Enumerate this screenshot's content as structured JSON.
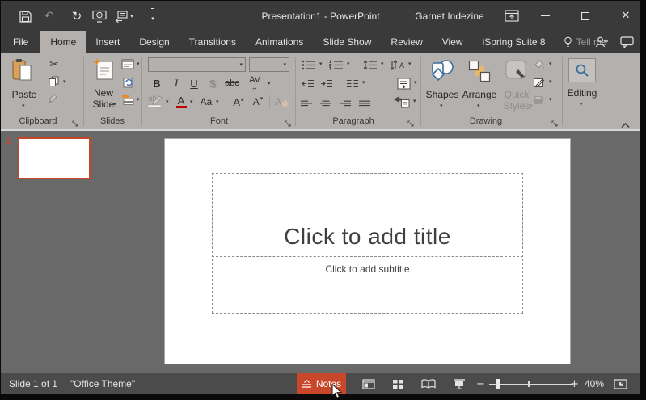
{
  "window": {
    "title": "Presentation1  -  PowerPoint",
    "account": "Garnet Indezine"
  },
  "colors": {
    "accent": "#c8462a",
    "chrome": "#3a3a3a",
    "ribbon_bg": "#b4b0ad",
    "canvas_bg": "#696969",
    "statusbar_bg": "#4b4b4b"
  },
  "icons": {
    "dropdown": "▾",
    "scissors": "✂",
    "undo": "↶",
    "repeat": "↻",
    "close": "✕",
    "zoom_out": "−",
    "zoom_in": "+",
    "spacing_arrows": "↔"
  },
  "tabs": {
    "items": [
      {
        "label": "File"
      },
      {
        "label": "Home"
      },
      {
        "label": "Insert"
      },
      {
        "label": "Design"
      },
      {
        "label": "Transitions"
      },
      {
        "label": "Animations"
      },
      {
        "label": "Slide Show"
      },
      {
        "label": "Review"
      },
      {
        "label": "View"
      },
      {
        "label": "iSpring Suite 8"
      }
    ],
    "active": "Home",
    "tellme": "Tell me"
  },
  "ribbon": {
    "clipboard": {
      "label": "Clipboard",
      "paste": "Paste"
    },
    "slides": {
      "label": "Slides",
      "new_slide_1": "New",
      "new_slide_2": "Slide"
    },
    "font": {
      "label": "Font",
      "bold": "B",
      "italic": "I",
      "underline": "U",
      "shadow": "S",
      "strike": "abc",
      "spacing": "AV",
      "highlight": "ab",
      "color": "A",
      "case": "Aa",
      "grow": "A",
      "shrink": "A",
      "clear": "A"
    },
    "paragraph": {
      "label": "Paragraph"
    },
    "drawing": {
      "label": "Drawing",
      "shapes": "Shapes",
      "arrange": "Arrange",
      "quick": "Quick",
      "styles": "Styles"
    },
    "editing": {
      "label": "Editing"
    }
  },
  "slide_area": {
    "slide_number": "1",
    "title_placeholder": "Click to add title",
    "subtitle_placeholder": "Click to add subtitle"
  },
  "statusbar": {
    "slide_counter": "Slide 1 of 1",
    "theme": "\"Office Theme\"",
    "notes": "Notes",
    "zoom": "40%"
  }
}
